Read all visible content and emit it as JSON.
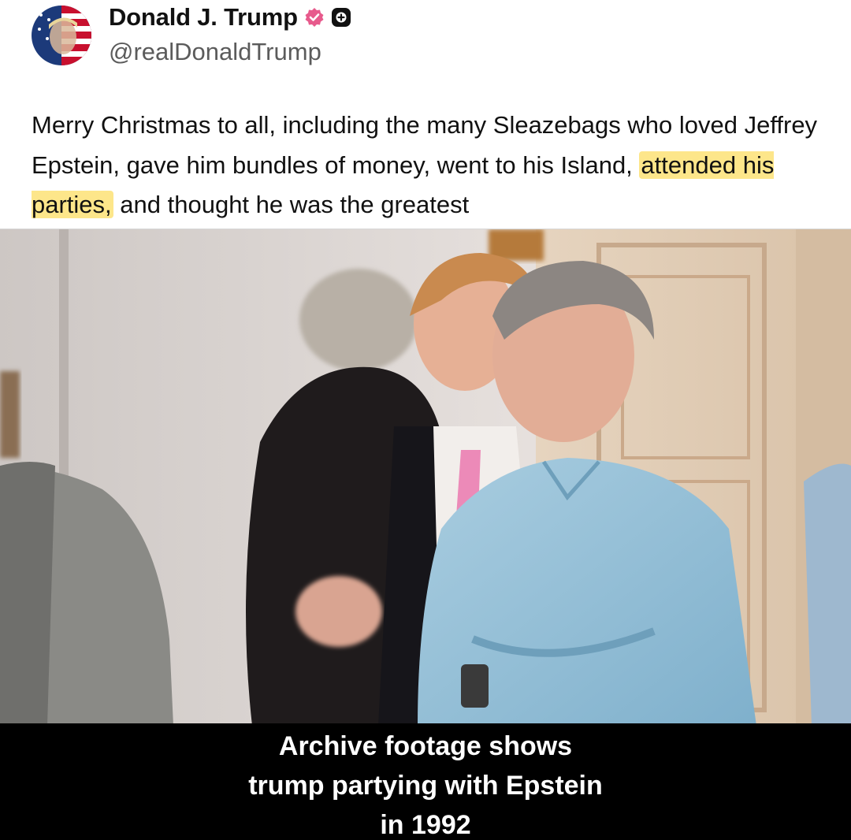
{
  "post": {
    "author": {
      "display_name": "Donald J. Trump",
      "handle": "@realDonaldTrump",
      "avatar_icon": "flag-portrait-avatar",
      "badges": [
        "verified-badge-icon",
        "affiliate-badge-icon"
      ],
      "verified_color": "#e75a8c"
    },
    "text": {
      "before_highlight": "Merry Christmas to all, including the many Sleazebags who loved Jeffrey Epstein, gave him bundles of money, went to his Island, ",
      "highlight": "attended his parties,",
      "after_highlight": " and thought he was the greatest"
    },
    "highlight_color": "#fde68a"
  },
  "media": {
    "type": "video-frame",
    "caption": {
      "line1": "Archive footage shows",
      "line2": "trump partying with Epstein",
      "line3": "in 1992"
    }
  }
}
